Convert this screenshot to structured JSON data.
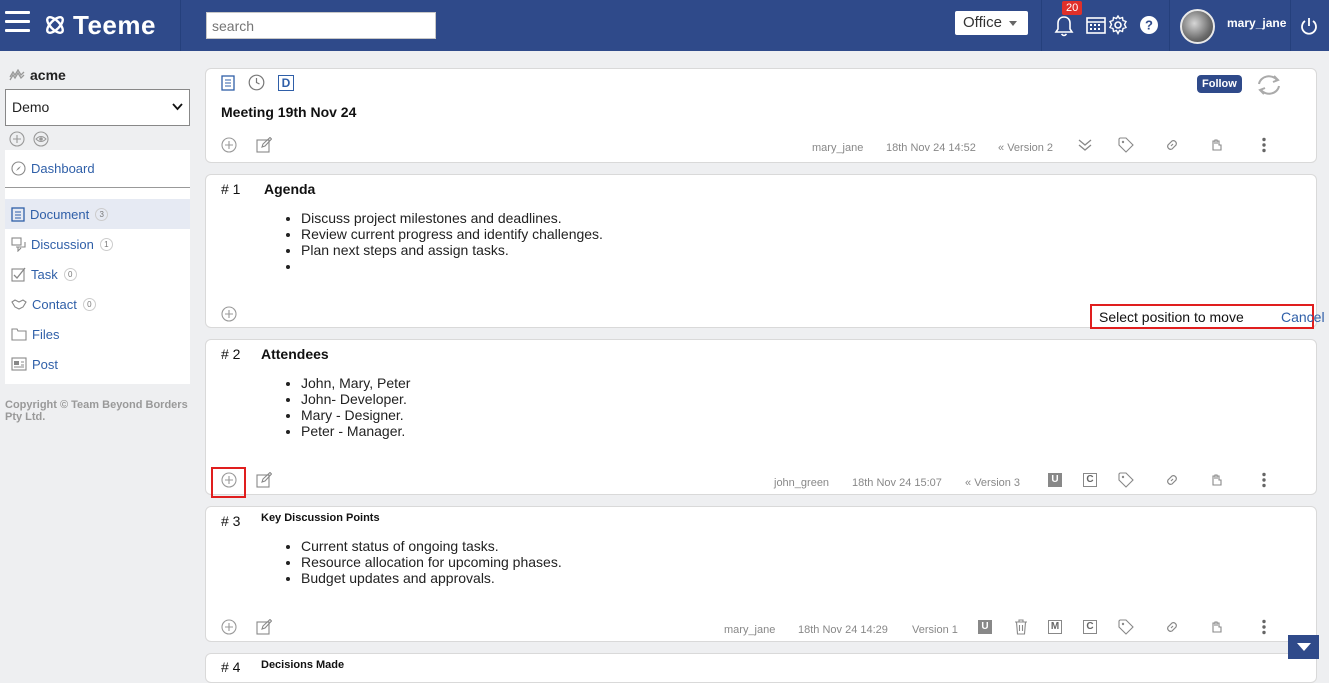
{
  "app": {
    "name": "Teeme"
  },
  "header": {
    "search_placeholder": "search",
    "office_label": "Office",
    "notification_count": "20",
    "username": "mary_jane"
  },
  "sidebar": {
    "org_name": "acme",
    "workspace_selected": "Demo",
    "dashboard_label": "Dashboard",
    "items": [
      {
        "label": "Document",
        "count": "3"
      },
      {
        "label": "Discussion",
        "count": "1"
      },
      {
        "label": "Task",
        "count": "0"
      },
      {
        "label": "Contact",
        "count": "0"
      },
      {
        "label": "Files"
      },
      {
        "label": "Post"
      }
    ],
    "copyright": "Copyright © Team Beyond Borders Pty Ltd."
  },
  "document": {
    "title": "Meeting 19th Nov 24",
    "follow_label": "Follow",
    "author": "mary_jane",
    "timestamp": "18th Nov 24 14:52",
    "version": "Version 2",
    "top_icon_letter": "D"
  },
  "sections": [
    {
      "number": "# 1",
      "title": "Agenda",
      "items": [
        "Discuss project milestones and deadlines.",
        "Review current progress and identify challenges.",
        "Plan next steps and assign tasks.",
        ""
      ],
      "move_prompt": "Select position to move",
      "cancel_label": "Cancel"
    },
    {
      "number": "# 2",
      "title": "Attendees",
      "items": [
        "John, Mary, Peter",
        "John- Developer.",
        "Mary - Designer.",
        "Peter - Manager."
      ],
      "author": "john_green",
      "timestamp": "18th Nov 24 15:07",
      "version": "Version 3",
      "badges": [
        "U",
        "C"
      ]
    },
    {
      "number": "# 3",
      "title": "Key Discussion Points",
      "items": [
        "Current status of ongoing tasks.",
        "Resource allocation for upcoming phases.",
        "Budget updates and approvals."
      ],
      "author": "mary_jane",
      "timestamp": "18th Nov 24 14:29",
      "version": "Version 1",
      "badges": [
        "U",
        "M",
        "C"
      ]
    },
    {
      "number": "# 4",
      "title": "Decisions Made"
    }
  ],
  "colors": {
    "header_bg": "#2f4a8a",
    "link": "#2f5fa8",
    "highlight": "#e01e1e"
  }
}
